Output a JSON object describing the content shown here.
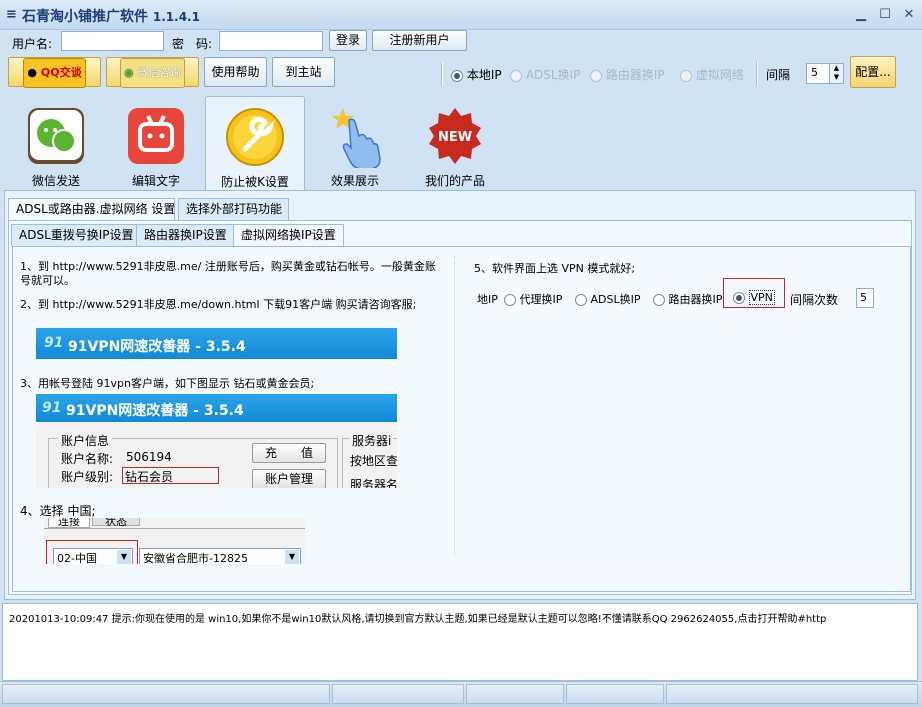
{
  "title": "石青淘小铺推广软件",
  "version": "1.1.4.1",
  "login": {
    "username_label": "用户名:",
    "password_label": "密　码:",
    "username_value": "",
    "password_value": "",
    "login_btn": "登录",
    "register_btn": "注册新用户"
  },
  "toolbar": {
    "qq_btn": "QQ交谈",
    "wechat_btn": "微信咨询",
    "help_btn": "使用帮助",
    "home_btn": "到主站",
    "radio_local": "本地IP",
    "radio_adsl": "ADSL换IP",
    "radio_router": "路由器换IP",
    "radio_vnet": "虚拟网络",
    "interval_label": "间隔",
    "interval_value": "5",
    "config_btn": "配置..."
  },
  "icons": [
    {
      "label": "微信发送",
      "name": "wechat-icon"
    },
    {
      "label": "编辑文字",
      "name": "edit-text-icon"
    },
    {
      "label": "防止被K设置",
      "name": "wrench-icon"
    },
    {
      "label": "效果展示",
      "name": "pointer-hand-icon"
    },
    {
      "label": "我们的产品",
      "name": "new-badge-icon"
    }
  ],
  "tabs_outer": [
    "ADSL或路由器.虚拟网络 设置",
    "选择外部打码功能"
  ],
  "tabs_inner": [
    "ADSL重拨号换IP设置",
    "路由器换IP设置",
    "虚拟网络换IP设置"
  ],
  "instructions": {
    "step1": "1、到 http://www.5291非皮恩.me/ 注册账号后，购买黄金或钻石帐号。一般黄金账号就可以。",
    "step2": "2、到 http://www.5291非皮恩.me/down.html 下载91客户端 购买请咨询客服;",
    "banner_text": "91VPN网速改善器 - 3.5.4",
    "banner_logo": "91",
    "step3": "3、用帐号登陆 91vpn客户端，如下图显示 钻石或黄金会员;",
    "account_group_title": "账户信息",
    "account_name_label": "账户名称:",
    "account_name_value": "506194",
    "account_level_label": "账户级别:",
    "account_level_value": "钻石会员",
    "recharge_btn": "充　　值",
    "manage_btn": "账户管理",
    "server_group_title": "服务器i",
    "server_region": "按地区查",
    "server_name": "服务器名",
    "step4": "4、选择 中国;",
    "tab_connect": "连接",
    "tab_status": "状态",
    "country_value": "02-中国",
    "region_value": "安徽省合肥市-12825"
  },
  "right_panel": {
    "step5": "5、软件界面上选 VPN 模式就好;",
    "opt_local": "地IP",
    "opt_proxy": "代理换IP",
    "opt_adsl": "ADSL换IP",
    "opt_router": "路由器换IP",
    "opt_vpn": "VPN",
    "interval_label": "间隔次数",
    "interval_value": "5"
  },
  "status_log": "20201013-10:09:47  提示:你现在使用的是 win10,如果你不是win10默认风格,请切换到官方默认主题,如果已经是默认主题可以忽略!不懂请联系QQ 2962624055,点击打开帮助#http"
}
